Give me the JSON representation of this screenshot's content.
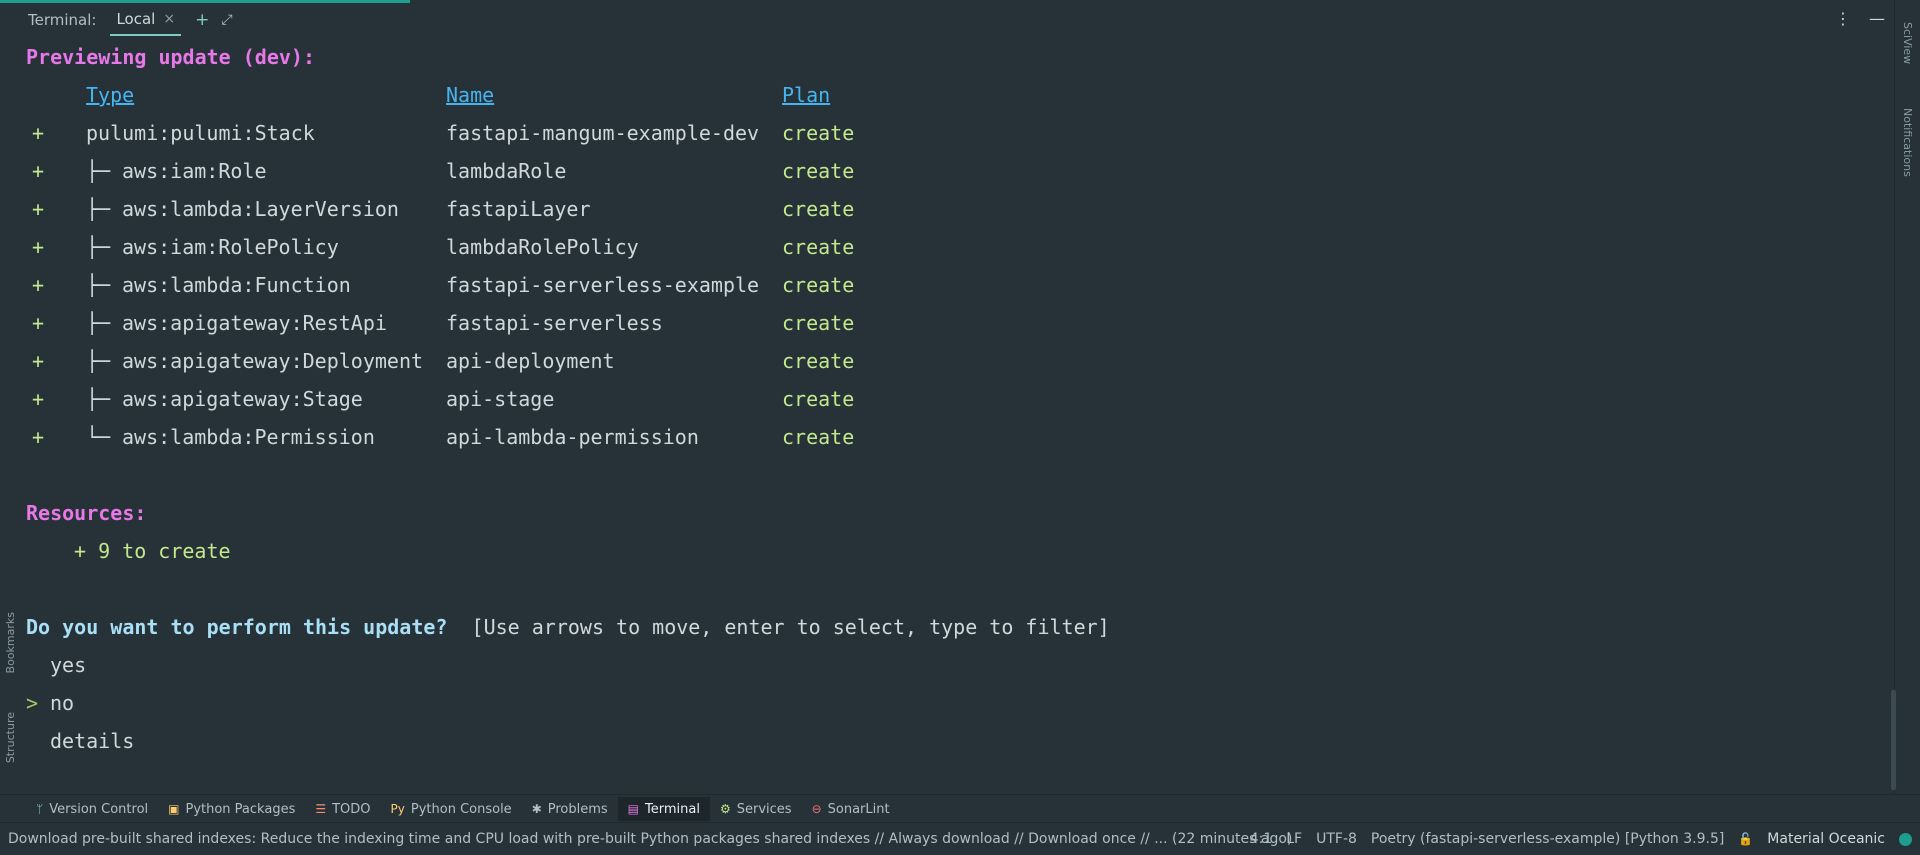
{
  "header": {
    "label": "Terminal:",
    "tab": "Local",
    "close": "×",
    "add": "+",
    "expand": "⤢",
    "more": "⋮",
    "minimize": "—"
  },
  "terminal": {
    "preview": "Previewing update (dev):",
    "col_type": "Type",
    "col_name": "Name",
    "col_plan": "Plan",
    "rows": [
      {
        "sign": "+",
        "tree": "",
        "type": "pulumi:pulumi:Stack",
        "name": "fastapi-mangum-example-dev",
        "plan": "create"
      },
      {
        "sign": "+",
        "tree": "├─ ",
        "type": "aws:iam:Role",
        "name": "lambdaRole",
        "plan": "create"
      },
      {
        "sign": "+",
        "tree": "├─ ",
        "type": "aws:lambda:LayerVersion",
        "name": "fastapiLayer",
        "plan": "create"
      },
      {
        "sign": "+",
        "tree": "├─ ",
        "type": "aws:iam:RolePolicy",
        "name": "lambdaRolePolicy",
        "plan": "create"
      },
      {
        "sign": "+",
        "tree": "├─ ",
        "type": "aws:lambda:Function",
        "name": "fastapi-serverless-example",
        "plan": "create"
      },
      {
        "sign": "+",
        "tree": "├─ ",
        "type": "aws:apigateway:RestApi",
        "name": "fastapi-serverless",
        "plan": "create"
      },
      {
        "sign": "+",
        "tree": "├─ ",
        "type": "aws:apigateway:Deployment",
        "name": "api-deployment",
        "plan": "create"
      },
      {
        "sign": "+",
        "tree": "├─ ",
        "type": "aws:apigateway:Stage",
        "name": "api-stage",
        "plan": "create"
      },
      {
        "sign": "+",
        "tree": "└─ ",
        "type": "aws:lambda:Permission",
        "name": "api-lambda-permission",
        "plan": "create"
      }
    ],
    "resources_label": "Resources:",
    "resources_summary": "+ 9 to create",
    "question": "Do you want to perform this update?",
    "hint": "[Use arrows to move, enter to select, type to filter]",
    "options": [
      "yes",
      "no",
      "details"
    ],
    "selected_marker": ">"
  },
  "side_right": {
    "sciview": "SciView",
    "notifications": "Notifications"
  },
  "side_left": {
    "bookmarks": "Bookmarks",
    "structure": "Structure"
  },
  "toolbar": {
    "items": [
      {
        "icon": "ᛘ",
        "label": "Version Control"
      },
      {
        "icon": "▣",
        "label": "Python Packages"
      },
      {
        "icon": "☰",
        "label": "TODO"
      },
      {
        "icon": "Py",
        "label": "Python Console"
      },
      {
        "icon": "✱",
        "label": "Problems"
      },
      {
        "icon": "▤",
        "label": "Terminal"
      },
      {
        "icon": "⚙",
        "label": "Services"
      },
      {
        "icon": "⊖",
        "label": "SonarLint"
      }
    ]
  },
  "status": {
    "message": "Download pre-built shared indexes: Reduce the indexing time and CPU load with pre-built Python packages shared indexes // Always download // Download once // ... (22 minutes ago)",
    "position": "4:1",
    "line_sep": "LF",
    "encoding": "UTF-8",
    "interpreter": "Poetry (fastapi-serverless-example) [Python 3.9.5]",
    "theme": "Material Oceanic"
  },
  "colors": {
    "bg": "#263238",
    "accent": "#80cbc4",
    "magenta": "#e878e8",
    "green": "#c3e88d",
    "link": "#46b4f0"
  }
}
